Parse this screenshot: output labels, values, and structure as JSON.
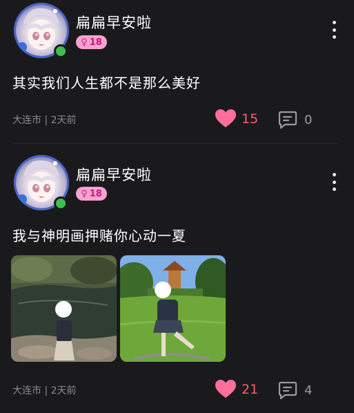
{
  "posts": [
    {
      "username": "扁扁早安啦",
      "badge": {
        "gender_symbol": "♀",
        "age": "18",
        "color": "#f5a3d2"
      },
      "content": "其实我们人生都不是那么美好",
      "meta": "大连市 | 2天前",
      "likes": "15",
      "comments": "0",
      "icons": {
        "like": "heart-icon",
        "comment": "comment-icon",
        "more": "more-vertical-icon"
      }
    },
    {
      "username": "扁扁早安啦",
      "badge": {
        "gender_symbol": "♀",
        "age": "18",
        "color": "#f5a3d2"
      },
      "content": "我与神明画押赌你心动一夏",
      "meta": "大连市 | 2天前",
      "likes": "21",
      "comments": "4",
      "photos": [
        "pond-photo",
        "park-photo"
      ],
      "icons": {
        "like": "heart-icon",
        "comment": "comment-icon",
        "more": "more-vertical-icon"
      }
    }
  ],
  "colors": {
    "background": "#1a1a1c",
    "like": "#ff5b6e",
    "meta": "#8a8a8e",
    "online": "#3fbf4a"
  }
}
